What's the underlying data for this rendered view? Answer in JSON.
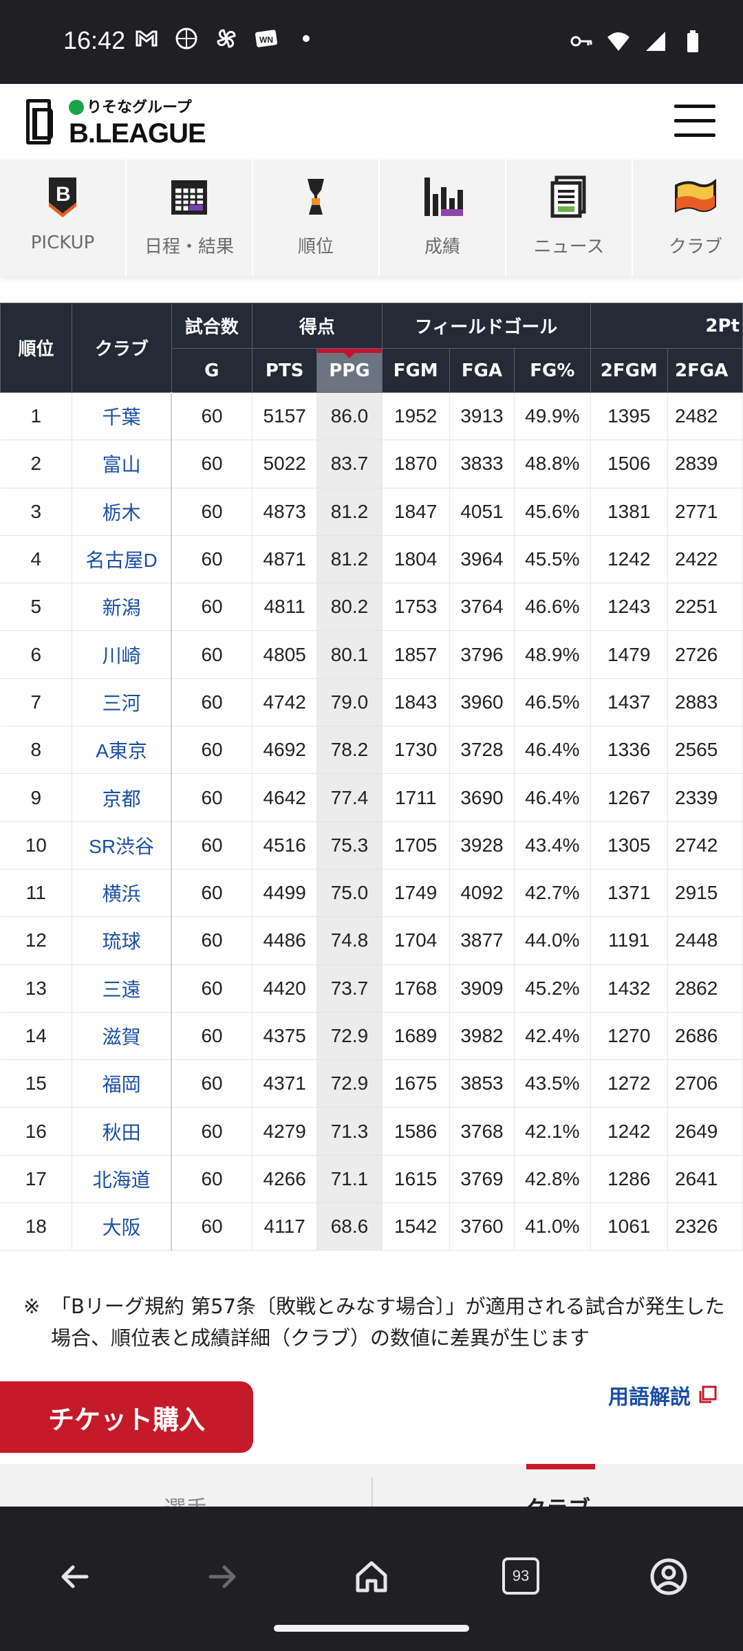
{
  "status_bar": {
    "time": "16:42",
    "left_icons": [
      "gmail-icon",
      "basketball-app-icon",
      "pinwheel-icon",
      "wn-app-icon",
      "dot-icon"
    ],
    "right_icons": [
      "key-icon",
      "wifi-icon",
      "signal-icon",
      "battery-icon"
    ]
  },
  "header": {
    "sponsor": "りそなグループ",
    "league": "B.LEAGUE",
    "menu_icon": "hamburger-icon"
  },
  "nav": {
    "items": [
      {
        "label": "PICKUP",
        "icon": "b-shield-icon"
      },
      {
        "label": "日程・結果",
        "icon": "calendar-icon"
      },
      {
        "label": "順位",
        "icon": "trophy-icon"
      },
      {
        "label": "成績",
        "icon": "bar-chart-icon"
      },
      {
        "label": "ニュース",
        "icon": "news-icon"
      },
      {
        "label": "クラブ",
        "icon": "flag-icon"
      }
    ]
  },
  "table": {
    "group_headers": {
      "rank": "順位",
      "club": "クラブ",
      "games": "試合数",
      "points": "得点",
      "field_goal": "フィールドゴール",
      "two_pt": "2Pt"
    },
    "sub_headers": {
      "g": "G",
      "pts": "PTS",
      "ppg": "PPG",
      "fgm": "FGM",
      "fga": "FGA",
      "fgpct": "FG%",
      "fgm2": "2FGM",
      "fga2": "2FGA"
    },
    "sorted_column": "PPG",
    "rows": [
      [
        "1",
        "千葉",
        "60",
        "5157",
        "86.0",
        "1952",
        "3913",
        "49.9%",
        "1395",
        "2482"
      ],
      [
        "2",
        "富山",
        "60",
        "5022",
        "83.7",
        "1870",
        "3833",
        "48.8%",
        "1506",
        "2839"
      ],
      [
        "3",
        "栃木",
        "60",
        "4873",
        "81.2",
        "1847",
        "4051",
        "45.6%",
        "1381",
        "2771"
      ],
      [
        "4",
        "名古屋D",
        "60",
        "4871",
        "81.2",
        "1804",
        "3964",
        "45.5%",
        "1242",
        "2422"
      ],
      [
        "5",
        "新潟",
        "60",
        "4811",
        "80.2",
        "1753",
        "3764",
        "46.6%",
        "1243",
        "2251"
      ],
      [
        "6",
        "川崎",
        "60",
        "4805",
        "80.1",
        "1857",
        "3796",
        "48.9%",
        "1479",
        "2726"
      ],
      [
        "7",
        "三河",
        "60",
        "4742",
        "79.0",
        "1843",
        "3960",
        "46.5%",
        "1437",
        "2883"
      ],
      [
        "8",
        "A東京",
        "60",
        "4692",
        "78.2",
        "1730",
        "3728",
        "46.4%",
        "1336",
        "2565"
      ],
      [
        "9",
        "京都",
        "60",
        "4642",
        "77.4",
        "1711",
        "3690",
        "46.4%",
        "1267",
        "2339"
      ],
      [
        "10",
        "SR渋谷",
        "60",
        "4516",
        "75.3",
        "1705",
        "3928",
        "43.4%",
        "1305",
        "2742"
      ],
      [
        "11",
        "横浜",
        "60",
        "4499",
        "75.0",
        "1749",
        "4092",
        "42.7%",
        "1371",
        "2915"
      ],
      [
        "12",
        "琉球",
        "60",
        "4486",
        "74.8",
        "1704",
        "3877",
        "44.0%",
        "1191",
        "2448"
      ],
      [
        "13",
        "三遠",
        "60",
        "4420",
        "73.7",
        "1768",
        "3909",
        "45.2%",
        "1432",
        "2862"
      ],
      [
        "14",
        "滋賀",
        "60",
        "4375",
        "72.9",
        "1689",
        "3982",
        "42.4%",
        "1270",
        "2686"
      ],
      [
        "15",
        "福岡",
        "60",
        "4371",
        "72.9",
        "1675",
        "3853",
        "43.5%",
        "1272",
        "2706"
      ],
      [
        "16",
        "秋田",
        "60",
        "4279",
        "71.3",
        "1586",
        "3768",
        "42.1%",
        "1242",
        "2649"
      ],
      [
        "17",
        "北海道",
        "60",
        "4266",
        "71.1",
        "1615",
        "3769",
        "42.8%",
        "1286",
        "2641"
      ],
      [
        "18",
        "大阪",
        "60",
        "4117",
        "68.6",
        "1542",
        "3760",
        "41.0%",
        "1061",
        "2326"
      ]
    ]
  },
  "footnote": {
    "mark": "※",
    "line1": "「Bリーグ規約 第57条〔敗戦とみなす場合〕」が適用される試合が発生した",
    "line2": "場合、順位表と成績詳細（クラブ）の数値に差異が生じます"
  },
  "ticket_button": "チケット購入",
  "glossary_link": "用語解説",
  "bottom_tabs": {
    "players": "選手",
    "clubs": "クラブ",
    "active": "クラブ"
  },
  "browser": {
    "tab_count": "93",
    "buttons": [
      "back-icon",
      "forward-icon",
      "home-icon",
      "tabs-icon",
      "account-icon"
    ]
  },
  "colors": {
    "header_dark": "#242b37",
    "sorted_header": "#6b7480",
    "accent_red": "#c41a2a",
    "link_blue": "#1a4fa3",
    "system_bar": "#1f1f24"
  }
}
